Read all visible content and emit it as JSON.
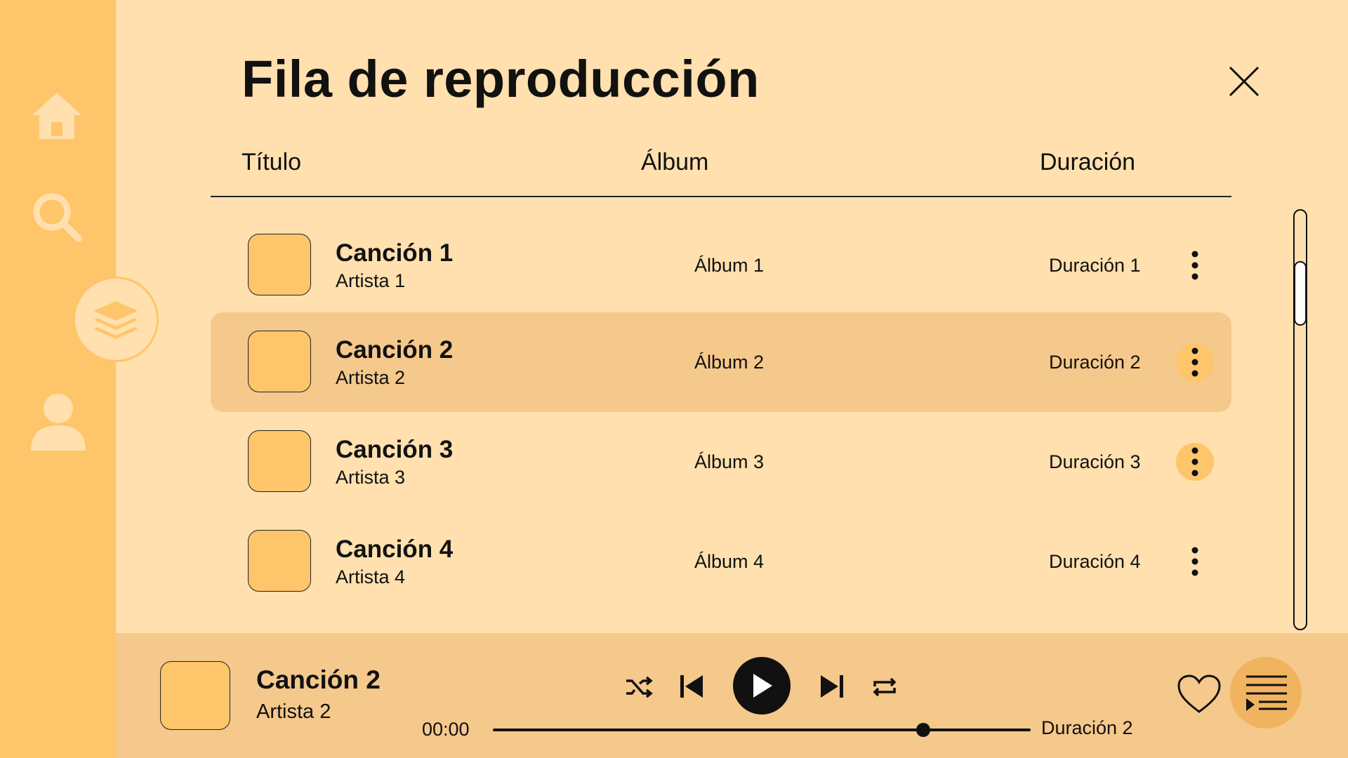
{
  "app": {
    "title": "Fila de reproducción"
  },
  "sidebar": {
    "items": [
      {
        "name": "home",
        "icon": "home-icon"
      },
      {
        "name": "search",
        "icon": "search-icon"
      },
      {
        "name": "queue",
        "icon": "layers-icon",
        "active": true
      },
      {
        "name": "profile",
        "icon": "user-icon"
      }
    ]
  },
  "table": {
    "headers": {
      "title": "Título",
      "album": "Álbum",
      "duration": "Duración"
    },
    "rows": [
      {
        "song": "Canción 1",
        "artist": "Artista 1",
        "album": "Álbum 1",
        "duration": "Duración 1",
        "active": false
      },
      {
        "song": "Canción 2",
        "artist": "Artista 2",
        "album": "Álbum 2",
        "duration": "Duración 2",
        "active": true
      },
      {
        "song": "Canción 3",
        "artist": "Artista 3",
        "album": "Álbum 3",
        "duration": "Duración 3",
        "active": false
      },
      {
        "song": "Canción 4",
        "artist": "Artista 4",
        "album": "Álbum 4",
        "duration": "Duración 4",
        "active": false
      }
    ]
  },
  "player": {
    "song": "Canción 2",
    "artist": "Artista 2",
    "current_time": "00:00",
    "total": "Duración 2",
    "progress": 0.8
  },
  "colors": {
    "background": "#FFE0AE",
    "sidebar": "#FFC56A",
    "highlight": "#F5C88B",
    "accent": "#FFC56A",
    "text": "#111111"
  }
}
